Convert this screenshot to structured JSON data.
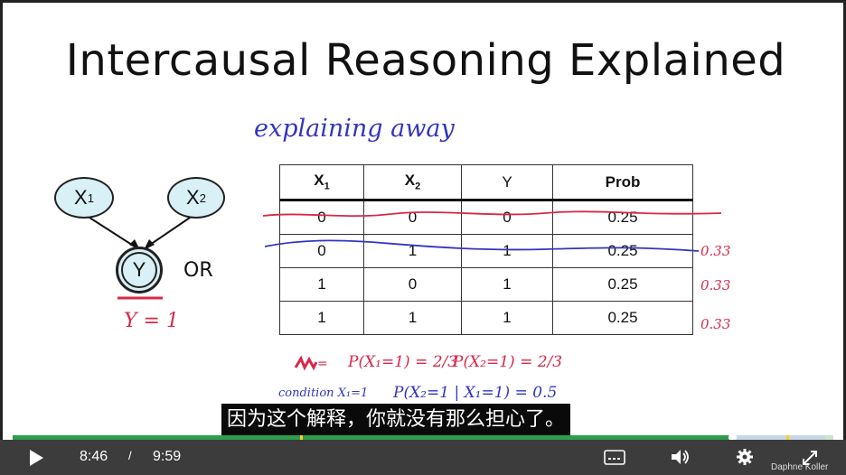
{
  "slide": {
    "title": "Intercausal Reasoning Explained",
    "annotation_explaining": "explaining away",
    "nodes": {
      "x1": {
        "base": "X",
        "sub": "1"
      },
      "x2": {
        "base": "X",
        "sub": "2"
      },
      "y": "Y"
    },
    "or_label": "OR",
    "y_eq": "Y = 1",
    "table": {
      "headers": [
        {
          "base": "X",
          "sub": "1"
        },
        {
          "base": "X",
          "sub": "2"
        },
        {
          "base": "Y",
          "sub": ""
        },
        {
          "base": "Prob",
          "sub": ""
        }
      ],
      "rows": [
        [
          "0",
          "0",
          "0",
          "0.25"
        ],
        [
          "0",
          "1",
          "1",
          "0.25"
        ],
        [
          "1",
          "0",
          "1",
          "0.25"
        ],
        [
          "1",
          "1",
          "1",
          "0.25"
        ]
      ]
    },
    "side_notes": [
      "0.33",
      "0.33",
      "0.33"
    ],
    "bottom_notes": {
      "scratch": "=",
      "p1": "P(X₁=1) = 2/3",
      "p2": "P(X₂=1) = 2/3",
      "condition": "condition X₁=1",
      "p3": "P(X₂=1 | X₁=1) = 0.5"
    },
    "watermark": "Daphne Koller"
  },
  "subtitle": "因为这个解释，你就没有那么担心了。",
  "player": {
    "current_time": "8:46",
    "separator": "/",
    "duration": "9:59",
    "progress_fraction": 0.877,
    "buffered_fraction": 0.99,
    "chapter_marker_fractions": [
      0.35,
      0.943
    ],
    "icons": [
      "play-icon",
      "captions-icon",
      "volume-icon",
      "settings-icon",
      "fullscreen-icon"
    ]
  }
}
